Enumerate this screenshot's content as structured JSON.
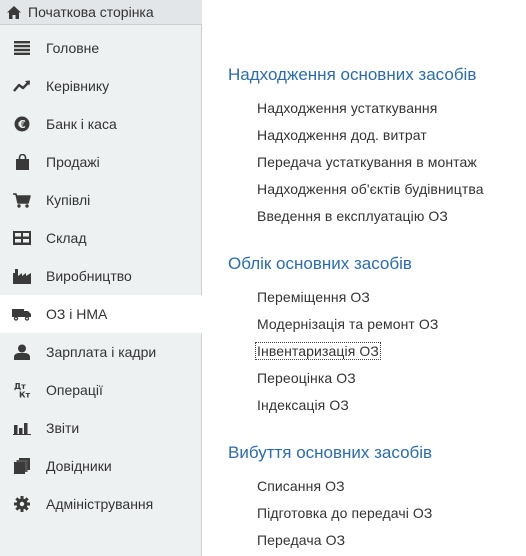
{
  "sidebar": {
    "home_label": "Початкова сторінка",
    "items": [
      {
        "label": "Головне",
        "icon": "menu-lines-icon"
      },
      {
        "label": "Керівнику",
        "icon": "trend-chart-icon"
      },
      {
        "label": "Банк і каса",
        "icon": "coins-icon"
      },
      {
        "label": "Продажі",
        "icon": "shopping-bag-icon"
      },
      {
        "label": "Купівлі",
        "icon": "cart-icon"
      },
      {
        "label": "Склад",
        "icon": "warehouse-grid-icon"
      },
      {
        "label": "Виробництво",
        "icon": "factory-icon"
      },
      {
        "label": "ОЗ і НМА",
        "icon": "truck-icon",
        "active": true
      },
      {
        "label": "Зарплата і кадри",
        "icon": "person-icon"
      },
      {
        "label": "Операції",
        "icon": "dt-kt-icon"
      },
      {
        "label": "Звіти",
        "icon": "bar-chart-icon"
      },
      {
        "label": "Довідники",
        "icon": "books-icon"
      },
      {
        "label": "Адміністрування",
        "icon": "gear-icon"
      }
    ]
  },
  "main": {
    "sections": [
      {
        "title": "Надходження основних засобів",
        "links": [
          "Надходження устаткування",
          "Надходження дод. витрат",
          "Передача устаткування в монтаж",
          "Надходження об'єктів будівництва",
          "Введення в експлуатацію ОЗ"
        ]
      },
      {
        "title": "Облік основних засобів",
        "links": [
          "Переміщення ОЗ",
          "Модернізація та ремонт ОЗ",
          "Інвентаризація ОЗ",
          "Переоцінка ОЗ",
          "Індексація ОЗ"
        ]
      },
      {
        "title": "Вибуття основних засобів",
        "links": [
          "Списання ОЗ",
          "Підготовка до передачі ОЗ",
          "Передача ОЗ"
        ]
      }
    ]
  },
  "colors": {
    "section_title": "#2b6cb0",
    "sidebar_bg": "#eef1f2",
    "icon": "#3a3a3a"
  }
}
